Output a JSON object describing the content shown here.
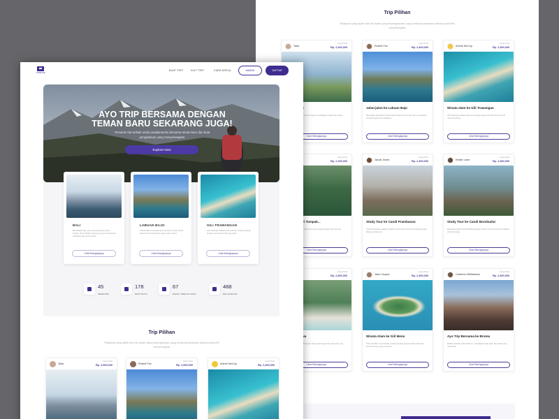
{
  "back": {
    "section_title": "Trip Pilihan",
    "section_sub": "Perjalanan yang dipilih oleh trip leader yang berpengalaman, yang membuat perjalanan akhirnya jadi lebih menyenangkan",
    "cards": [
      {
        "name": "Talia",
        "price_label": "Harga Mulai",
        "price": "Rp. 2,300,000",
        "title": "...rna Remote Worker",
        "desc": "Nikmati suasana kerja remote dengan pemandangan sawah dan pantai terbaik di pulau dewata.",
        "button": "Lihat Selengkapnya"
      },
      {
        "name": "Robert Fox",
        "price_label": "Harga Mulai",
        "price": "Rp. 2,400,000",
        "title": "Jalan-jalan ke Labuan Bajo",
        "desc": "Menjelajahi keindahan Labuan Bajo bersama teman baru dan menyaksikan komodo langsung di habitatnya.",
        "button": "Lihat Selengkapnya"
      },
      {
        "name": "Arlene McCoy",
        "price_label": "Harga Mulai",
        "price": "Rp. 2,300,000",
        "title": "Wisata alam ke Gili Trawangan",
        "desc": "Gili Trawangan adalah pulau kecil dengan pasir putih dan laut biru jernih untuk snorkeling.",
        "button": "Lihat Selengkapnya"
      },
      {
        "name": "...",
        "price_label": "Harga Mulai",
        "price": "Rp. 2,100,000",
        "title": "...mandangan dari Tumpak...",
        "desc": "Menikmati air terjun Tumpak Sewu yang megah dengan latar Gunung Semeru di kejauhan.",
        "button": "Lihat Selengkapnya"
      },
      {
        "name": "Jacob Jones",
        "price_label": "Harga Mulai",
        "price": "Rp. 2,300,000",
        "title": "Study Tour ke Candi Prambanan",
        "desc": "Candi Prambanan adalah kompleks candi Hindu terbesar di Indonesia yang dibangun abad ke-9.",
        "button": "Lihat Selengkapnya"
      },
      {
        "name": "Kristin Lane",
        "price_label": "Harga Mulai",
        "price": "Rp. 2,300,000",
        "title": "Study Tour ke Candi Borobudur",
        "desc": "Mengenal sejarah candi Buddha terbesar di dunia sambil menikmati matahari terbit dari stupa.",
        "button": "Lihat Selengkapnya"
      },
      {
        "name": "...Russell",
        "price_label": "Harga Mulai",
        "price": "Rp. 2,300,000",
        "title": "...i Pantai Pandawa",
        "desc": "Pantai Pandawa dikenal dengan tebing kapur tinggi dan pasir putih yang bersih di Bali selatan.",
        "button": "Lihat Selengkapnya"
      },
      {
        "name": "Jane Cooper",
        "price_label": "Harga Mulai",
        "price": "Rp. 2,300,000",
        "title": "Wisata Alam ke Gili Meno",
        "desc": "Pulau Gili Meno menawarkan suasana tenang dengan pantai indah dan terumbu karang yang memukau.",
        "button": "Lihat Selengkapnya"
      },
      {
        "name": "Cameron Williamson",
        "price_label": "Harga Mulai",
        "price": "Rp. 2,300,000",
        "title": "Ayo Trip Bersama ke Broma",
        "desc": "Melihat matahari terbit di Bromo, menjelajahi lautan pasir, dan kawah yang masih aktif.",
        "button": "Lihat Selengkapnya"
      }
    ]
  },
  "front": {
    "logo_text": "HOPEHUB",
    "nav": {
      "item1": "BUAT TRIP",
      "item2": "IKUT TRIP",
      "item3": "CARA KERJA",
      "masuk": "MASUK",
      "daftar": "DAFTAR"
    },
    "hero": {
      "title": "AYO TRIP BERSAMA DENGAN TEMAN BARU SEKARANG JUGA!",
      "subtitle": "Temukan trip terbaik untuk perjalananmu bersama teman baru dan buat pengalaman yang menyenangkan",
      "button": "Explore Now"
    },
    "destinations": [
      {
        "title": "BALI",
        "desc": "Bali adalah pulau yang terkenal dengan pantai, budaya, dan keindahan alamnya yang memukau para wisatawan dari seluruh dunia.",
        "button": "Lihat Selengkapnya"
      },
      {
        "title": "LABUAN BAJO",
        "desc": "Labuan Bajo merupakan pintu gerbang menuju Taman Nasional Komodo dengan pulau-pulau eksotis.",
        "button": "Lihat Selengkapnya"
      },
      {
        "title": "GILI TRAWANGAN",
        "desc": "Gili Trawangan adalah pulau terbesar di antara tiga gili dengan pantai pasir putih yang indah.",
        "button": "Lihat Selengkapnya"
      }
    ],
    "stats": [
      {
        "value": "45",
        "label": "PEMANDU"
      },
      {
        "value": "178",
        "label": "DESTINASI"
      },
      {
        "value": "67",
        "label": "PAKET PERJALANAN"
      },
      {
        "value": "488",
        "label": "PELANGGAN"
      }
    ],
    "section_title": "Trip Pilihan",
    "section_sub": "Perjalanan yang dipilih oleh trip leader yang berpengalaman, yang membuat perjalanan akhirnya jadi lebih menyenangkan",
    "cards": [
      {
        "name": "Talia",
        "price_label": "Harga Mulai",
        "price": "Rp. 4,300,000"
      },
      {
        "name": "Robert Fox",
        "price_label": "Harga Mulai",
        "price": "Rp. 2,500,000"
      },
      {
        "name": "Arlene McCoy",
        "price_label": "Harga Mulai",
        "price": "Rp. 2,400,000"
      }
    ]
  },
  "colors": {
    "accent": "#3f2c8e",
    "background": "#66656a"
  }
}
